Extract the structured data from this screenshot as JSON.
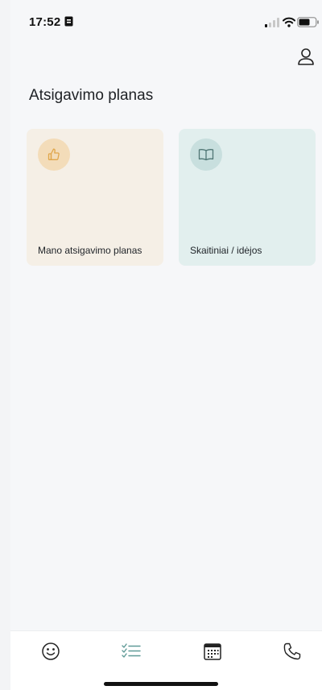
{
  "status_bar": {
    "time": "17:52",
    "icons": [
      "sim-card-icon",
      "signal-icon",
      "wifi-icon",
      "battery-icon"
    ]
  },
  "header": {
    "profile_icon": "user-icon"
  },
  "page": {
    "title": "Atsigavimo planas"
  },
  "cards": [
    {
      "label": "Mano atsigavimo planas",
      "icon": "thumbs-up-icon",
      "accent": "#f3dcb9",
      "background": "#f5efe6",
      "icon_color": "#e0a64a"
    },
    {
      "label": "Skaitiniai / idėjos",
      "icon": "book-icon",
      "accent": "#c8dfde",
      "background": "#e2efee",
      "icon_color": "#5f8c8a"
    }
  ],
  "bottom_nav": {
    "items": [
      {
        "icon": "smiley-icon",
        "active": false
      },
      {
        "icon": "checklist-icon",
        "active": true
      },
      {
        "icon": "calendar-icon",
        "active": false
      },
      {
        "icon": "phone-icon",
        "active": false
      }
    ],
    "active_color": "#5f9a97"
  }
}
